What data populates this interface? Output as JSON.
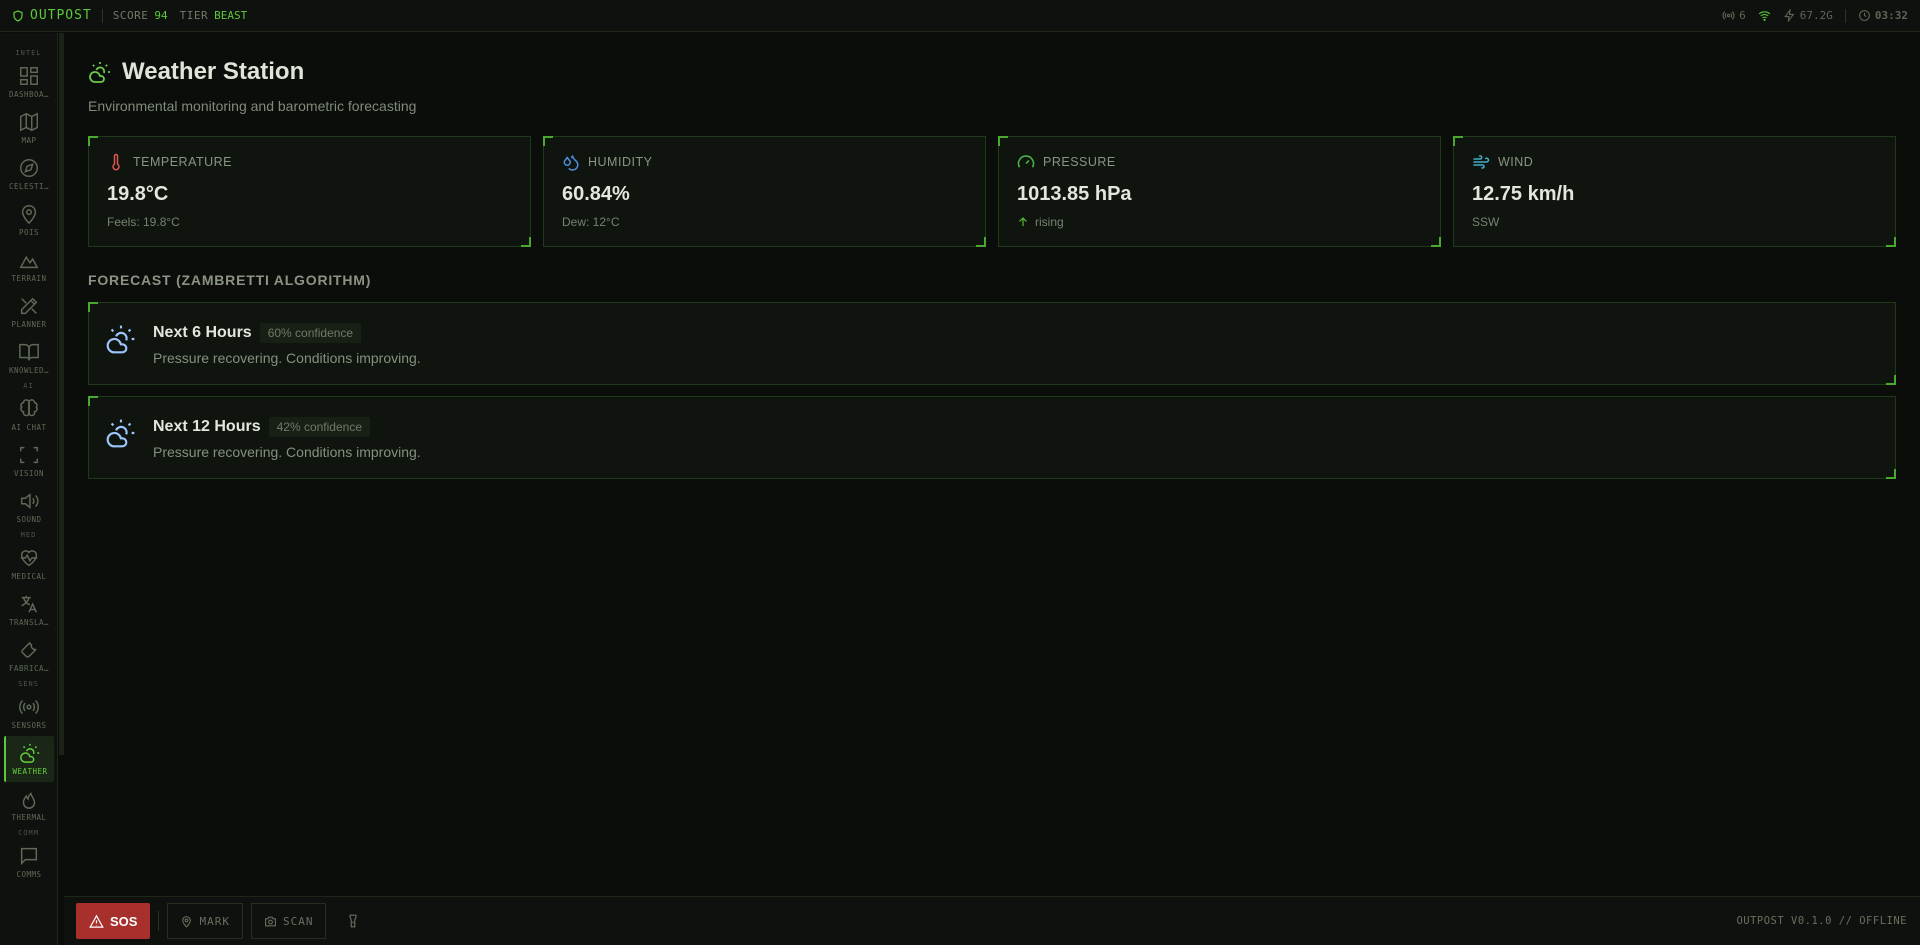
{
  "topbar": {
    "brand": "OUTPOST",
    "score_label": "SCORE",
    "score_value": "94",
    "tier_label": "TIER",
    "tier_value": "BEAST",
    "radio_count": "6",
    "power": "67.2G",
    "time": "03:32"
  },
  "sidebar": {
    "sections": [
      "INTEL",
      "AI",
      "MED",
      "SENS",
      "COMM"
    ],
    "items": [
      {
        "label": "DASHBOA…",
        "icon": "dashboard-icon"
      },
      {
        "label": "MAP",
        "icon": "map-icon"
      },
      {
        "label": "CELESTI…",
        "icon": "compass-icon"
      },
      {
        "label": "POIS",
        "icon": "map-pin-icon"
      },
      {
        "label": "TERRAIN",
        "icon": "mountain-icon"
      },
      {
        "label": "PLANNER",
        "icon": "pencil-ruler-icon"
      },
      {
        "label": "KNOWLED…",
        "icon": "book-icon"
      },
      {
        "label": "AI CHAT",
        "icon": "brain-icon"
      },
      {
        "label": "VISION",
        "icon": "scan-icon"
      },
      {
        "label": "SOUND",
        "icon": "speaker-icon"
      },
      {
        "label": "MEDICAL",
        "icon": "heart-pulse-icon"
      },
      {
        "label": "TRANSLA…",
        "icon": "translate-icon"
      },
      {
        "label": "FABRICA…",
        "icon": "wrench-icon"
      },
      {
        "label": "SENSORS",
        "icon": "radio-icon"
      },
      {
        "label": "WEATHER",
        "icon": "cloud-sun-icon"
      },
      {
        "label": "THERMAL",
        "icon": "flame-icon"
      },
      {
        "label": "COMMS",
        "icon": "chat-icon"
      }
    ],
    "active": "WEATHER"
  },
  "page": {
    "title": "Weather Station",
    "subtitle": "Environmental monitoring and barometric forecasting"
  },
  "cards": [
    {
      "label": "TEMPERATURE",
      "value": "19.8°C",
      "sub": "Feels: 19.8°C",
      "icon": "thermometer-icon",
      "color": "#e05555"
    },
    {
      "label": "HUMIDITY",
      "value": "60.84%",
      "sub": "Dew: 12°C",
      "icon": "droplets-icon",
      "color": "#4a8fe0"
    },
    {
      "label": "PRESSURE",
      "value": "1013.85 hPa",
      "sub": "rising",
      "icon": "gauge-icon",
      "color": "#4cb84a"
    },
    {
      "label": "WIND",
      "value": "12.75 km/h",
      "sub": "SSW",
      "icon": "wind-icon",
      "color": "#3fb0c9"
    }
  ],
  "forecast": {
    "heading": "FORECAST (ZAMBRETTI ALGORITHM)",
    "items": [
      {
        "title": "Next 6 Hours",
        "confidence": "60% confidence",
        "desc": "Pressure recovering. Conditions improving."
      },
      {
        "title": "Next 12 Hours",
        "confidence": "42% confidence",
        "desc": "Pressure recovering. Conditions improving."
      }
    ]
  },
  "bottombar": {
    "sos": "SOS",
    "mark": "MARK",
    "scan": "SCAN",
    "version": "OUTPOST V0.1.0 // OFFLINE"
  }
}
